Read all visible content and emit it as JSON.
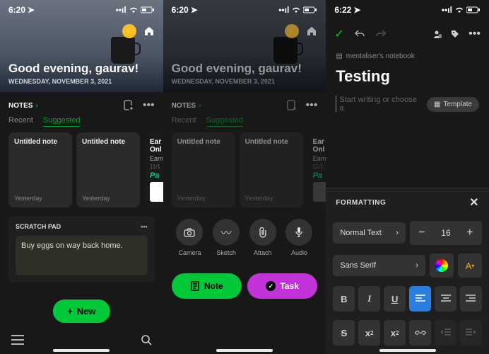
{
  "panel1": {
    "time": "6:20",
    "greeting": "Good evening, gaurav!",
    "date": "WEDNESDAY, NOVEMBER 3, 2021",
    "notes_label": "NOTES",
    "create_icon": "note-add",
    "tabs": {
      "recent": "Recent",
      "suggested": "Suggested"
    },
    "cards": [
      {
        "title": "Untitled note",
        "meta": "Yesterday"
      },
      {
        "title": "Untitled note",
        "meta": "Yesterday"
      }
    ],
    "promo": {
      "title": "Ear",
      "sub": "Onl",
      "date": "11/1",
      "brand": "Pa"
    },
    "scratch": {
      "label": "SCRATCH PAD",
      "text": "Buy eggs on way back home."
    },
    "new_btn": "New"
  },
  "panel2": {
    "time": "6:20",
    "greeting": "Good evening, gaurav!",
    "date": "WEDNESDAY, NOVEMBER 3, 2021",
    "notes_label": "NOTES",
    "tabs": {
      "recent": "Recent",
      "suggested": "Suggested"
    },
    "cards": [
      {
        "title": "Untitled note",
        "meta": "Yesterday"
      },
      {
        "title": "Untitled note",
        "meta": "Yesterday"
      }
    ],
    "promo": {
      "title": "Ear",
      "sub": "Onl",
      "date": "11/1",
      "brand": "Pa"
    },
    "actions": {
      "camera": "Camera",
      "sketch": "Sketch",
      "attach": "Attach",
      "audio": "Audio"
    },
    "note_btn": "Note",
    "task_btn": "Task"
  },
  "panel3": {
    "time": "6:22",
    "breadcrumb": "mentaliser's notebook",
    "title": "Testing",
    "placeholder": "Start writing or choose a",
    "template_btn": "Template",
    "formatting": {
      "label": "FORMATTING",
      "style": "Normal Text",
      "font": "Sans Serif",
      "size": "16"
    }
  }
}
